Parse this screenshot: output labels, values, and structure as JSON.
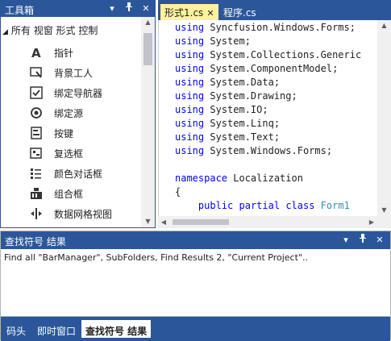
{
  "toolbox": {
    "title": "工具箱",
    "pin_glyph": "▾",
    "dock_glyph": "†",
    "close_glyph": "✕",
    "group_label": "所有 视窗 形式 控制",
    "items": [
      {
        "label": "指针",
        "icon": "pointer-icon"
      },
      {
        "label": "背景工人",
        "icon": "background-worker-icon"
      },
      {
        "label": "绑定导航器",
        "icon": "binding-navigator-icon"
      },
      {
        "label": "绑定源",
        "icon": "binding-source-icon"
      },
      {
        "label": "按键",
        "icon": "button-icon"
      },
      {
        "label": "复选框",
        "icon": "checkbox-icon"
      },
      {
        "label": "颜色对话框",
        "icon": "color-dialog-icon"
      },
      {
        "label": "组合框",
        "icon": "combobox-icon"
      },
      {
        "label": "数据网格视图",
        "icon": "datagridview-icon"
      }
    ]
  },
  "editor": {
    "tabs": [
      {
        "label": "形式1.cs",
        "active": true,
        "close_glyph": "✕"
      },
      {
        "label": "程序.cs",
        "active": false
      }
    ],
    "code_lines": [
      [
        {
          "t": "using",
          "k": "kw"
        },
        {
          "t": " Syncfusion.Windows.Forms;"
        }
      ],
      [
        {
          "t": "using",
          "k": "kw"
        },
        {
          "t": " System;"
        }
      ],
      [
        {
          "t": "using",
          "k": "kw"
        },
        {
          "t": " System.Collections.Generic"
        }
      ],
      [
        {
          "t": "using",
          "k": "kw"
        },
        {
          "t": " System.ComponentModel;"
        }
      ],
      [
        {
          "t": "using",
          "k": "kw"
        },
        {
          "t": " System.Data;"
        }
      ],
      [
        {
          "t": "using",
          "k": "kw"
        },
        {
          "t": " System.Drawing;"
        }
      ],
      [
        {
          "t": "using",
          "k": "kw"
        },
        {
          "t": " System.IO;"
        }
      ],
      [
        {
          "t": "using",
          "k": "kw"
        },
        {
          "t": " System.Linq;"
        }
      ],
      [
        {
          "t": "using",
          "k": "kw"
        },
        {
          "t": " System.Text;"
        }
      ],
      [
        {
          "t": "using",
          "k": "kw"
        },
        {
          "t": " System.Windows.Forms;"
        }
      ],
      [],
      [
        {
          "t": "namespace",
          "k": "kw"
        },
        {
          "t": " Localization"
        }
      ],
      [
        {
          "t": "{"
        }
      ],
      [
        {
          "t": "    "
        },
        {
          "t": "public",
          "k": "kw"
        },
        {
          "t": " "
        },
        {
          "t": "partial",
          "k": "kw"
        },
        {
          "t": " "
        },
        {
          "t": "class",
          "k": "kw"
        },
        {
          "t": " "
        },
        {
          "t": "Form1",
          "k": "tp"
        }
      ]
    ]
  },
  "results": {
    "title": "查找符号 结果",
    "line": "Find all \"BarManager\", SubFolders, Find Results 2, \"Current Project\"..",
    "bottom_tabs": [
      {
        "label": "码头",
        "active": false
      },
      {
        "label": "即时窗口",
        "active": false
      },
      {
        "label": "查找符号 结果",
        "active": true
      }
    ]
  },
  "colors": {
    "title_bar": "#2b579a",
    "active_tab": "#fff29d",
    "keyword": "#0000ff",
    "type": "#2b91af"
  }
}
